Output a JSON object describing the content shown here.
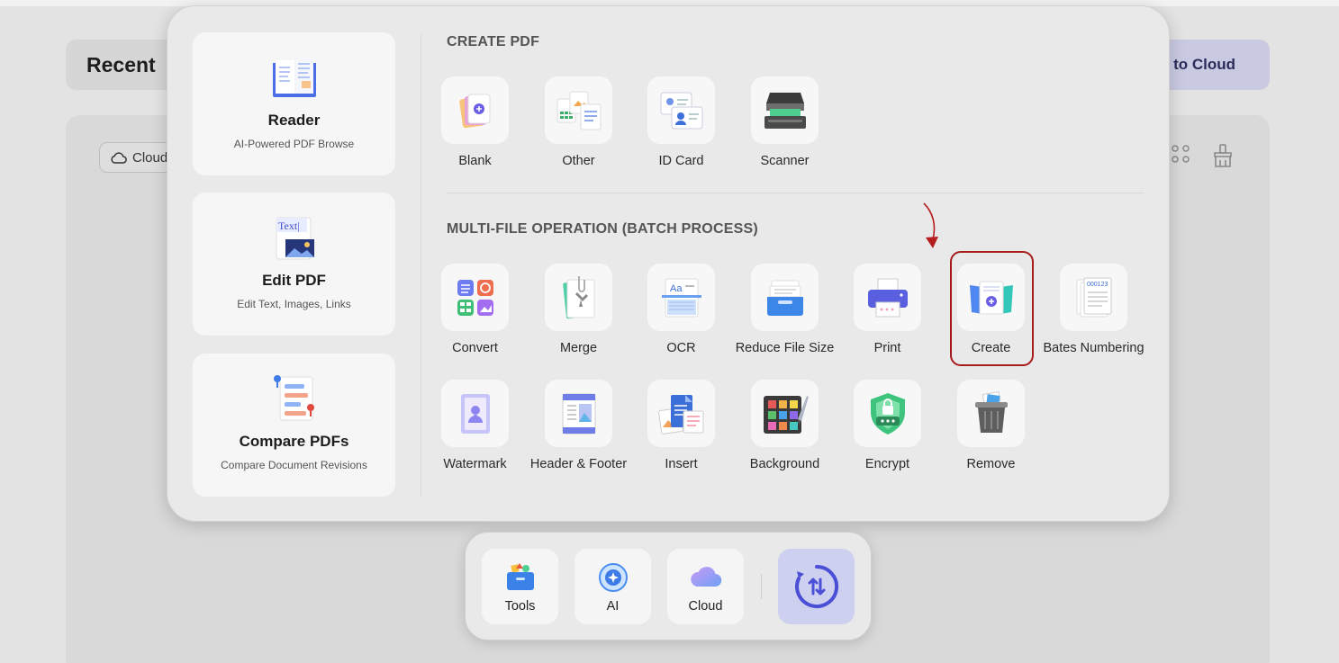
{
  "background": {
    "recent_title": "Recent",
    "cloud_upload_label": "to Cloud",
    "cloud_chip_label": "Cloud"
  },
  "feature_cards": [
    {
      "title": "Reader",
      "subtitle": "AI-Powered PDF Browse",
      "icon": "reader-book-icon"
    },
    {
      "title": "Edit PDF",
      "subtitle": "Edit Text, Images, Links",
      "icon": "edit-text-icon"
    },
    {
      "title": "Compare PDFs",
      "subtitle": "Compare Document Revisions",
      "icon": "compare-icon"
    }
  ],
  "create_pdf": {
    "title": "CREATE PDF",
    "tools": [
      {
        "label": "Blank",
        "icon": "blank-pdf-icon"
      },
      {
        "label": "Other",
        "icon": "other-files-icon"
      },
      {
        "label": "ID Card",
        "icon": "id-card-icon"
      },
      {
        "label": "Scanner",
        "icon": "scanner-icon"
      }
    ]
  },
  "batch": {
    "title": "MULTI-FILE OPERATION (BATCH PROCESS)",
    "row1": [
      {
        "label": "Convert",
        "icon": "convert-icon"
      },
      {
        "label": "Merge",
        "icon": "merge-icon"
      },
      {
        "label": "OCR",
        "icon": "ocr-icon"
      },
      {
        "label": "Reduce File Size",
        "icon": "reduce-size-icon"
      },
      {
        "label": "Print",
        "icon": "print-icon"
      },
      {
        "label": "Create",
        "icon": "create-icon"
      },
      {
        "label": "Bates Numbering",
        "icon": "bates-numbering-icon"
      }
    ],
    "row2": [
      {
        "label": "Watermark",
        "icon": "watermark-icon"
      },
      {
        "label": "Header & Footer",
        "icon": "header-footer-icon"
      },
      {
        "label": "Insert",
        "icon": "insert-icon"
      },
      {
        "label": "Background",
        "icon": "background-icon"
      },
      {
        "label": "Encrypt",
        "icon": "encrypt-icon"
      },
      {
        "label": "Remove",
        "icon": "remove-trash-icon"
      }
    ],
    "highlighted": "Create"
  },
  "dock": {
    "items": [
      {
        "label": "Tools",
        "icon": "tools-icon"
      },
      {
        "label": "AI",
        "icon": "ai-icon"
      },
      {
        "label": "Cloud",
        "icon": "cloud-icon"
      }
    ],
    "main_icon": "switch-icon"
  },
  "colors": {
    "accent": "#5b5fe0",
    "highlight_border": "#a61b1b",
    "panel_bg": "#e9e9e9"
  }
}
